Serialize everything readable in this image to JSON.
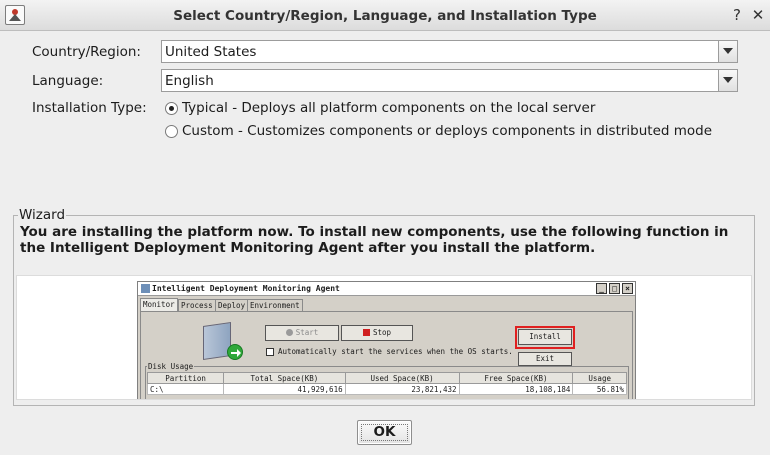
{
  "window": {
    "title": "Select Country/Region, Language, and Installation Type",
    "help_glyph": "?",
    "close_glyph": "✕"
  },
  "form": {
    "country_label": "Country/Region:",
    "country_value": "United States",
    "language_label": "Language:",
    "language_value": "English",
    "install_type_label": "Installation Type:",
    "install_options": [
      {
        "label": "Typical - Deploys all platform components on the local server",
        "selected": true
      },
      {
        "label": "Custom - Customizes components or deploys components in distributed mode",
        "selected": false
      }
    ]
  },
  "wizard": {
    "group_title": "Wizard",
    "text": "You are installing the platform now. To install new components, use the following function in the Intelligent Deployment Monitoring Agent after you install the platform.",
    "agent": {
      "title": "Intelligent Deployment Monitoring Agent",
      "tabs": [
        "Monitor",
        "Process",
        "Deploy",
        "Environment"
      ],
      "start_label": "Start",
      "stop_label": "Stop",
      "install_label": "Install",
      "exit_label": "Exit",
      "autostart_label": "Automatically start the services when the OS starts.",
      "disk_usage_title": "Disk Usage",
      "disk_headers": [
        "Partition",
        "Total Space(KB)",
        "Used Space(KB)",
        "Free Space(KB)",
        "Usage"
      ],
      "disk_rows": [
        [
          "C:\\",
          "41,929,616",
          "23,821,432",
          "18,108,184",
          "56.81%"
        ]
      ],
      "highlight_color": "#e02020"
    }
  },
  "footer": {
    "ok_label": "OK"
  }
}
